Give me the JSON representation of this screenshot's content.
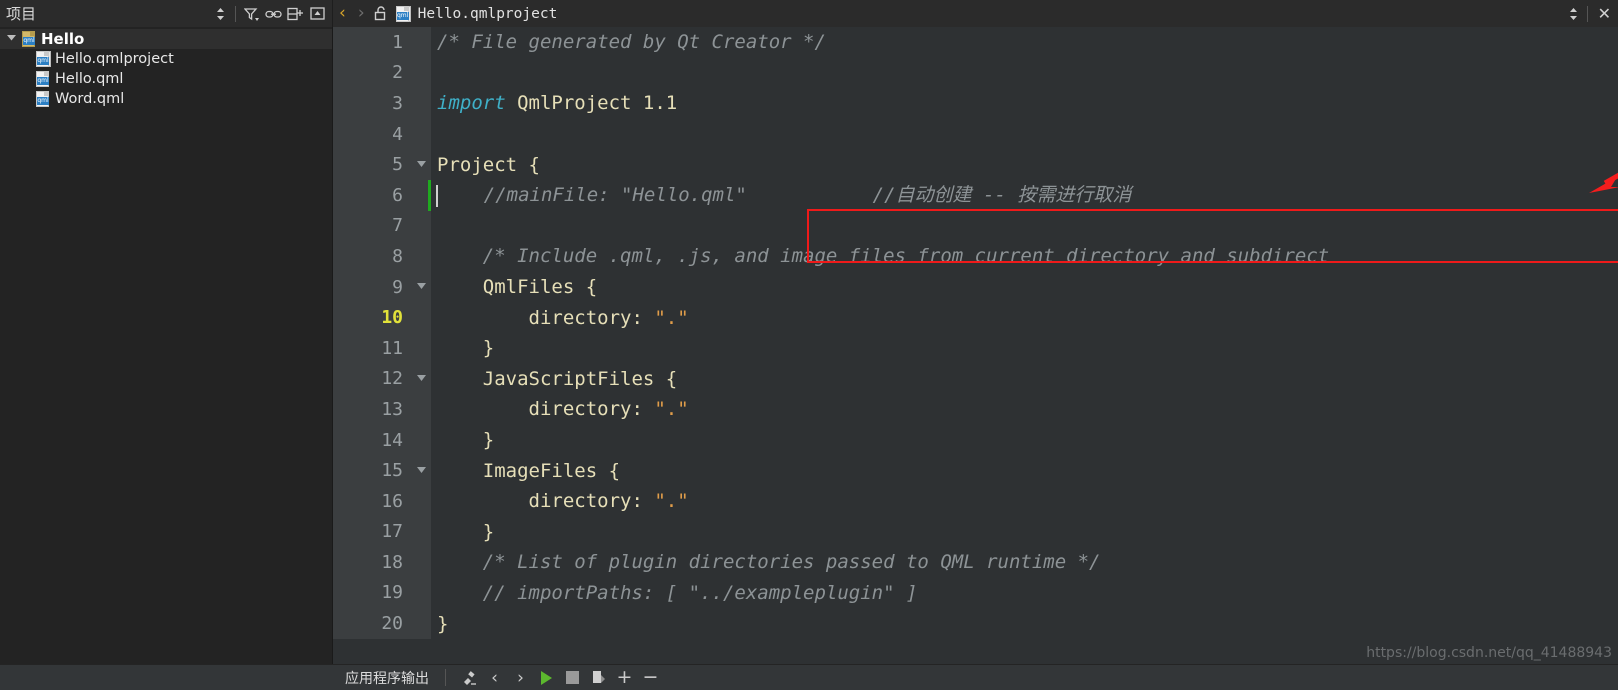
{
  "sidebar": {
    "title": "项目",
    "toolbar_icons": [
      {
        "name": "sort-updown-icon",
        "glyph": "⇅"
      },
      {
        "name": "filter-icon",
        "glyph": "▼"
      },
      {
        "name": "link-icon",
        "glyph": "⚭"
      },
      {
        "name": "split-add-icon",
        "glyph": "⊞"
      },
      {
        "name": "collapse-icon",
        "glyph": "▣"
      }
    ],
    "tree": [
      {
        "label": "Hello",
        "icon": "qml-folder-icon",
        "level": 0,
        "selected": true,
        "expanded": true
      },
      {
        "label": "Hello.qmlproject",
        "icon": "qmlproject-file-icon",
        "level": 1,
        "selected": false
      },
      {
        "label": "Hello.qml",
        "icon": "qml-file-icon",
        "level": 1,
        "selected": false
      },
      {
        "label": "Word.qml",
        "icon": "qml-file-icon",
        "level": 1,
        "selected": false
      }
    ]
  },
  "editor_header": {
    "back_label": "‹",
    "forward_label": "›",
    "lock_icon": "unlocked-padlock-icon",
    "file_icon": "qmlproject-file-icon",
    "filename": "Hello.qmlproject",
    "dropdown_label": "⇅",
    "close_label": "✕"
  },
  "code": {
    "current_line": 10,
    "changed_line": 6,
    "lines": [
      {
        "n": 1,
        "fold": "",
        "tokens": [
          {
            "t": "/* File generated by Qt Creator */",
            "c": "cmt"
          }
        ]
      },
      {
        "n": 2,
        "fold": "",
        "tokens": []
      },
      {
        "n": 3,
        "fold": "",
        "tokens": [
          {
            "t": "import",
            "c": "kw"
          },
          {
            "t": " QmlProject 1.1",
            "c": "id"
          }
        ]
      },
      {
        "n": 4,
        "fold": "",
        "tokens": []
      },
      {
        "n": 5,
        "fold": "▼",
        "tokens": [
          {
            "t": "Project {",
            "c": "id"
          }
        ]
      },
      {
        "n": 6,
        "fold": "",
        "tokens": [
          {
            "t": "    //mainFile: \"Hello.qml\"           //自动创建 -- 按需进行取消",
            "c": "cmt"
          }
        ]
      },
      {
        "n": 7,
        "fold": "",
        "tokens": []
      },
      {
        "n": 8,
        "fold": "",
        "tokens": [
          {
            "t": "    /* Include .qml, .js, and image files from current directory and subdirect",
            "c": "cmt"
          }
        ]
      },
      {
        "n": 9,
        "fold": "▼",
        "tokens": [
          {
            "t": "    QmlFiles {",
            "c": "id"
          }
        ]
      },
      {
        "n": 10,
        "fold": "",
        "tokens": [
          {
            "t": "        directory: ",
            "c": "id"
          },
          {
            "t": "\".\"",
            "c": "str"
          }
        ]
      },
      {
        "n": 11,
        "fold": "",
        "tokens": [
          {
            "t": "    }",
            "c": "id"
          }
        ]
      },
      {
        "n": 12,
        "fold": "▼",
        "tokens": [
          {
            "t": "    JavaScriptFiles {",
            "c": "id"
          }
        ]
      },
      {
        "n": 13,
        "fold": "",
        "tokens": [
          {
            "t": "        directory: ",
            "c": "id"
          },
          {
            "t": "\".\"",
            "c": "str"
          }
        ]
      },
      {
        "n": 14,
        "fold": "",
        "tokens": [
          {
            "t": "    }",
            "c": "id"
          }
        ]
      },
      {
        "n": 15,
        "fold": "▼",
        "tokens": [
          {
            "t": "    ImageFiles {",
            "c": "id"
          }
        ]
      },
      {
        "n": 16,
        "fold": "",
        "tokens": [
          {
            "t": "        directory: ",
            "c": "id"
          },
          {
            "t": "\".\"",
            "c": "str"
          }
        ]
      },
      {
        "n": 17,
        "fold": "",
        "tokens": [
          {
            "t": "    }",
            "c": "id"
          }
        ]
      },
      {
        "n": 18,
        "fold": "",
        "tokens": [
          {
            "t": "    /* List of plugin directories passed to QML runtime */",
            "c": "cmt"
          }
        ]
      },
      {
        "n": 19,
        "fold": "",
        "tokens": [
          {
            "t": "    // importPaths: [ \"../exampleplugin\" ]",
            "c": "cmt"
          }
        ]
      },
      {
        "n": 20,
        "fold": "",
        "tokens": [
          {
            "t": "}",
            "c": "id"
          }
        ]
      }
    ]
  },
  "annotations": {
    "box_color": "#ef1a1a",
    "arrow_color": "#f41d1d",
    "watermark": "https://blog.csdn.net/qq_41488943"
  },
  "bottom": {
    "label": "应用程序输出",
    "icons": [
      {
        "name": "clear-output-icon",
        "glyph": "⚒"
      },
      {
        "name": "prev-item-icon",
        "glyph": "‹"
      },
      {
        "name": "next-item-icon",
        "glyph": "›"
      },
      {
        "name": "run-icon",
        "glyph": ""
      },
      {
        "name": "stop-icon",
        "glyph": ""
      },
      {
        "name": "attach-debugger-icon",
        "glyph": "◥"
      },
      {
        "name": "zoom-in-icon",
        "glyph": "+"
      },
      {
        "name": "zoom-out-icon",
        "glyph": "−"
      }
    ]
  }
}
